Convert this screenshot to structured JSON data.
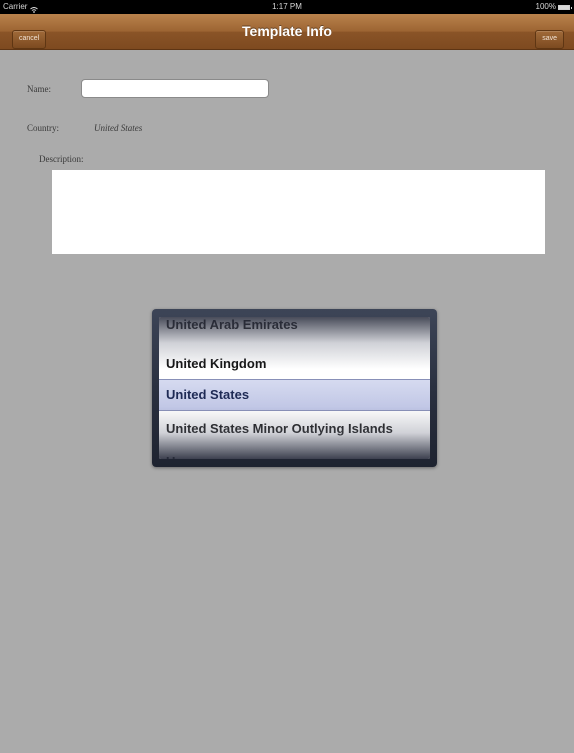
{
  "status_bar": {
    "carrier": "Carrier",
    "time": "1:17 PM",
    "battery": "100%"
  },
  "nav": {
    "title": "Template Info",
    "cancel_label": "cancel",
    "save_label": "save"
  },
  "form": {
    "name_label": "Name:",
    "name_value": "",
    "country_label": "Country:",
    "country_value": "United States",
    "description_label": "Description:",
    "description_value": ""
  },
  "picker": {
    "options": [
      "United Arab Emirates",
      "United Kingdom",
      "United States",
      "United States Minor Outlying Islands",
      "Uruguay"
    ],
    "selected": "United States"
  },
  "colors": {
    "background": "#ababab",
    "nav_bar": "#9c6432",
    "picker_selection": "#bcc3e6"
  },
  "icons": [
    "wifi-icon",
    "battery-icon"
  ]
}
